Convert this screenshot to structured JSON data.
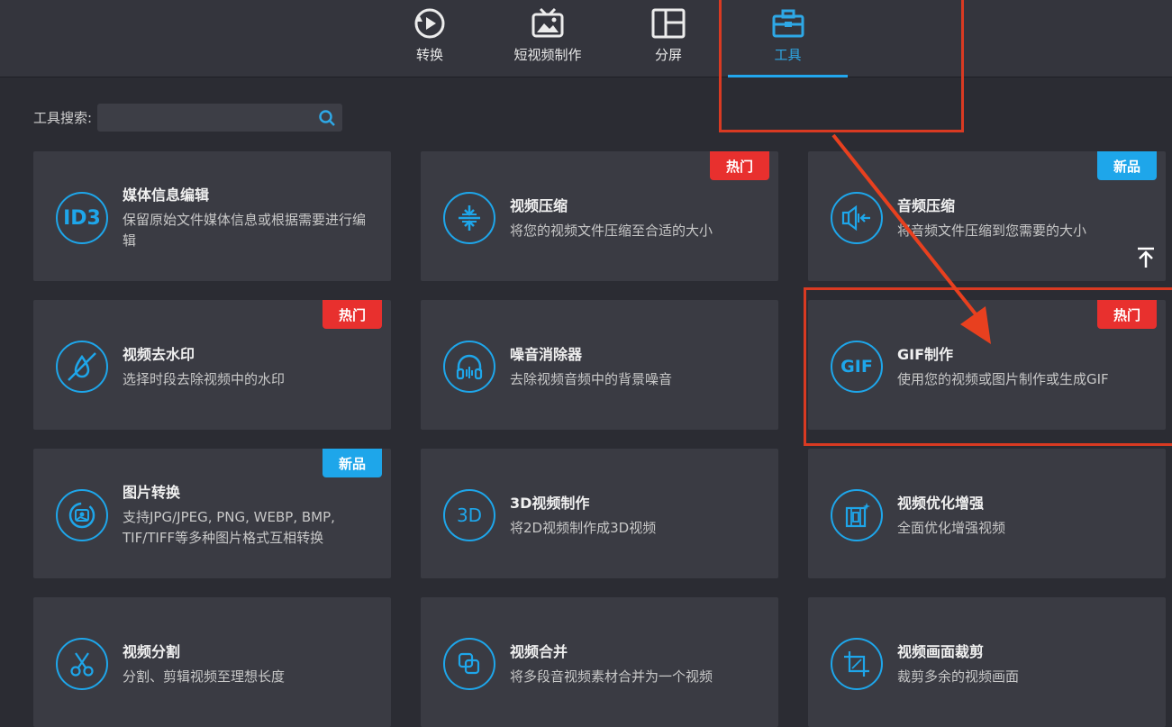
{
  "tabs": [
    {
      "label": "转换",
      "icon": "convert-icon"
    },
    {
      "label": "短视频制作",
      "icon": "short-video-icon"
    },
    {
      "label": "分屏",
      "icon": "split-screen-icon"
    },
    {
      "label": "工具",
      "icon": "toolbox-icon",
      "active": true
    }
  ],
  "search": {
    "label": "工具搜索:",
    "value": "",
    "placeholder": ""
  },
  "badges": {
    "hot": "热门",
    "new": "新品"
  },
  "colors": {
    "accent": "#1ea6ea",
    "hot": "#e8302e",
    "new": "#1ea6ea",
    "annotation": "#d93a22"
  },
  "tools": [
    {
      "title": "媒体信息编辑",
      "desc": "保留原始文件媒体信息或根据需要进行编辑",
      "icon": "id3-icon",
      "icon_text": "ID3",
      "badge": ""
    },
    {
      "title": "视频压缩",
      "desc": "将您的视频文件压缩至合适的大小",
      "icon": "compress-icon",
      "badge": "热门"
    },
    {
      "title": "音频压缩",
      "desc": "将音频文件压缩到您需要的大小",
      "icon": "audio-compress-icon",
      "badge": "新品"
    },
    {
      "title": "视频去水印",
      "desc": "选择时段去除视频中的水印",
      "icon": "watermark-remove-icon",
      "badge": "热门"
    },
    {
      "title": "噪音消除器",
      "desc": "去除视频音频中的背景噪音",
      "icon": "headphones-icon",
      "badge": ""
    },
    {
      "title": "GIF制作",
      "desc": "使用您的视频或图片制作或生成GIF",
      "icon": "gif-icon",
      "icon_text": "GIF",
      "badge": "热门"
    },
    {
      "title": "图片转换",
      "desc": "支持JPG/JPEG, PNG, WEBP, BMP, TIF/TIFF等多种图片格式互相转换",
      "icon": "image-convert-icon",
      "badge": "新品"
    },
    {
      "title": "3D视频制作",
      "desc": "将2D视频制作成3D视频",
      "icon": "3d-icon",
      "icon_text": "3D",
      "badge": ""
    },
    {
      "title": "视频优化增强",
      "desc": "全面优化增强视频",
      "icon": "enhance-icon",
      "badge": ""
    },
    {
      "title": "视频分割",
      "desc": "分割、剪辑视频至理想长度",
      "icon": "scissors-icon",
      "badge": ""
    },
    {
      "title": "视频合并",
      "desc": "将多段音视频素材合并为一个视频",
      "icon": "merge-icon",
      "badge": ""
    },
    {
      "title": "视频画面裁剪",
      "desc": "裁剪多余的视频画面",
      "icon": "crop-icon",
      "badge": ""
    }
  ]
}
